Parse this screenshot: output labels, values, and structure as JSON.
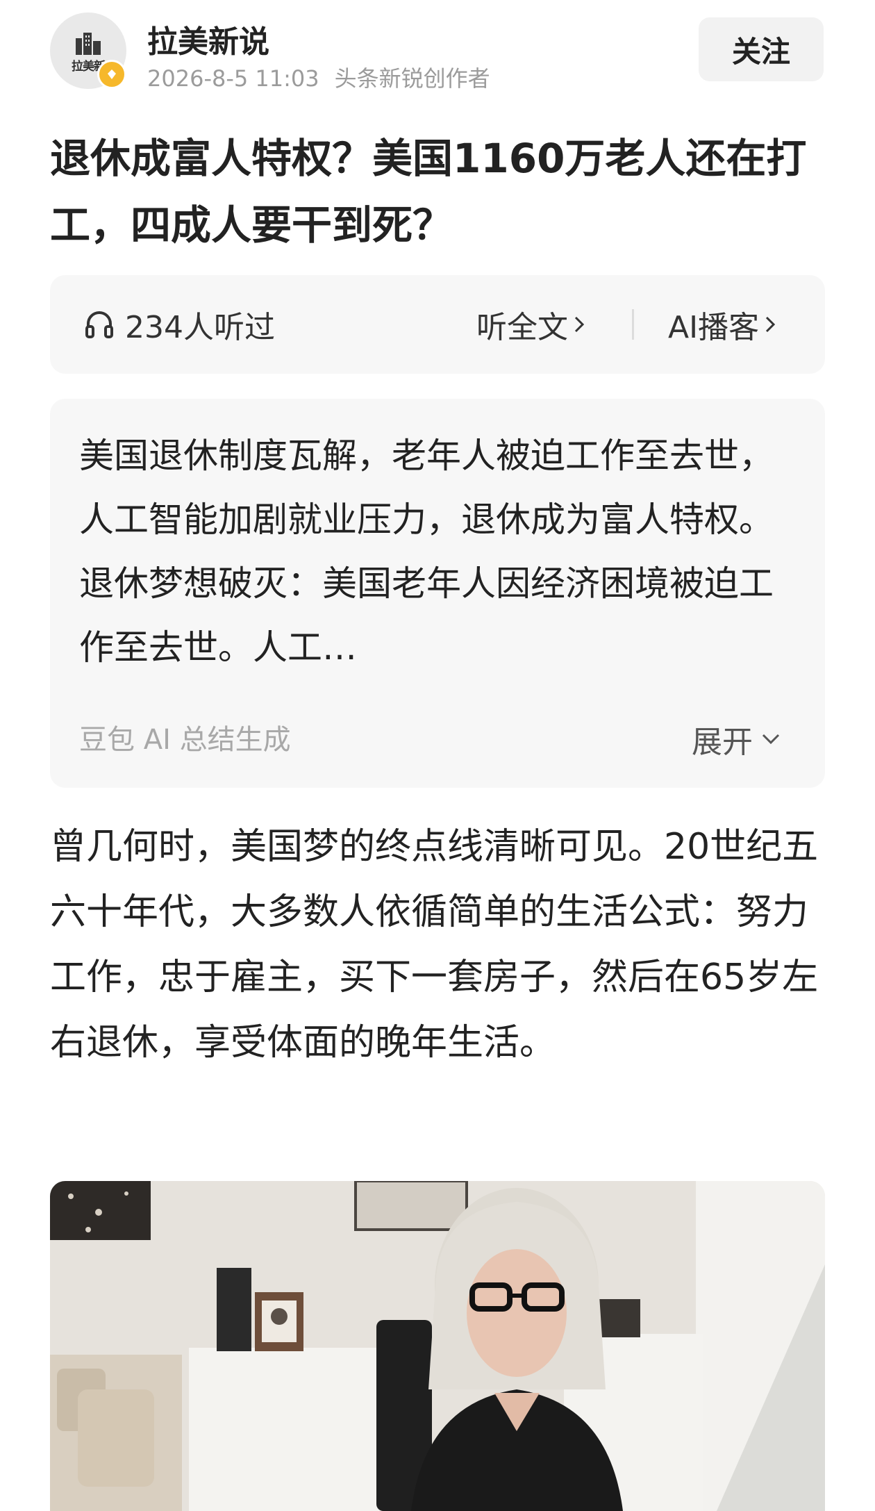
{
  "author": {
    "avatar_text": "拉美新",
    "name": "拉美新说",
    "date": "2026-8-5 11:03",
    "role": "头条新锐创作者"
  },
  "follow_label": "关注",
  "article": {
    "title": "退休成富人特权？美国1160万老人还在打工，四成人要干到死？"
  },
  "listen": {
    "count": "234人听过",
    "full_text": "听全文",
    "ai_podcast": "AI播客"
  },
  "summary": {
    "text": "美国退休制度瓦解，老年人被迫工作至去世，人工智能加剧就业压力，退休成为富人特权。退休梦想破灭：美国老年人因经济困境被迫工作至去世。人工…",
    "source": "豆包 AI 总结生成",
    "expand": "展开"
  },
  "body": {
    "paragraph_1": "曾几何时，美国梦的终点线清晰可见。20世纪五六十年代，大多数人依循简单的生活公式：努力工作，忠于雇主，买下一套房子，然后在65岁左右退休，享受体面的晚年生活。"
  },
  "icons": {
    "headphones": "headphones-icon",
    "chevron_right": "chevron-right-icon",
    "chevron_down": "chevron-down-icon",
    "verified": "verified-badge-icon",
    "building": "building-logo-icon"
  },
  "colors": {
    "verified_badge": "#f6b82b",
    "card_background": "#f7f7f7",
    "muted_text": "#9b9b9b"
  }
}
